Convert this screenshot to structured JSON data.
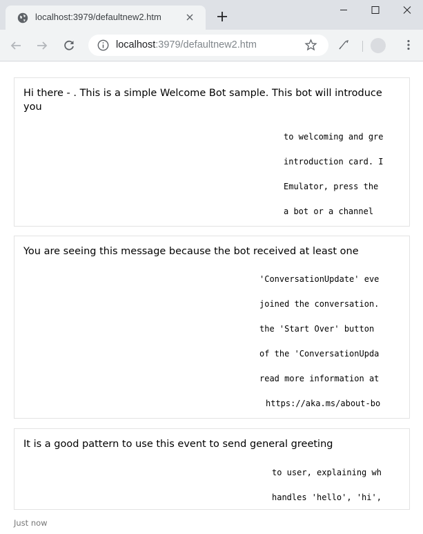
{
  "browser": {
    "tab": {
      "title": "localhost:3979/defaultnew2.htm"
    },
    "address_bar": {
      "host": "localhost",
      "rest": ":3979/defaultnew2.htm"
    }
  },
  "messages": [
    {
      "text": "Hi there - . This is a simple Welcome Bot sample. This bot will introduce you",
      "code_lines": [
        "to welcoming and gre",
        "introduction card. I",
        "Emulator, press the",
        "a bot or a channel"
      ]
    },
    {
      "text": "You are seeing this message because the bot received at least one",
      "code_lines": [
        "'ConversationUpdate' eve",
        "joined the conversation.",
        "the 'Start Over' button",
        "of the 'ConversationUpda",
        "read more information at",
        "https://aka.ms/about-bo"
      ]
    },
    {
      "text": "It is a good pattern to use this event to send general greeting",
      "code_lines": [
        "to user, explaining wh",
        "handles 'hello', 'hi',"
      ]
    }
  ],
  "timestamp": "Just now"
}
